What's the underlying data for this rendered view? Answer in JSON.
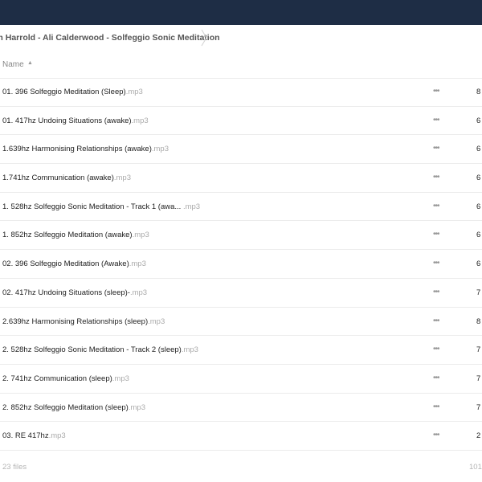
{
  "breadcrumb": {
    "text": "nn Harrold - Ali Calderwood - Solfeggio Sonic Meditation"
  },
  "header": {
    "name_label": "Name",
    "sort_icon": "sort-ascending-icon"
  },
  "files": [
    {
      "name": "01. 396 Solfeggio Meditation (Sleep)",
      "ext": ".mp3",
      "size": "8"
    },
    {
      "name": "01. 417hz Undoing Situations (awake)",
      "ext": ".mp3",
      "size": "6"
    },
    {
      "name": "1.639hz Harmonising Relationships (awake)",
      "ext": ".mp3",
      "size": "6"
    },
    {
      "name": "1.741hz Communication (awake)",
      "ext": ".mp3",
      "size": "6"
    },
    {
      "name": "1. 528hz Solfeggio Sonic Meditation - Track 1 (awa...",
      "ext": " .mp3",
      "size": "6"
    },
    {
      "name": "1. 852hz Solfeggio Meditation (awake)",
      "ext": ".mp3",
      "size": "6"
    },
    {
      "name": "02. 396 Solfeggio Meditation (Awake)",
      "ext": ".mp3",
      "size": "6"
    },
    {
      "name": "02. 417hz Undoing Situations (sleep)-",
      "ext": ".mp3",
      "size": "7"
    },
    {
      "name": "2.639hz Harmonising Relationships (sleep)",
      "ext": ".mp3",
      "size": "8"
    },
    {
      "name": "2. 528hz Solfeggio Sonic Meditation - Track 2 (sleep)",
      "ext": ".mp3",
      "size": "7"
    },
    {
      "name": "2. 741hz Communication (sleep)",
      "ext": ".mp3",
      "size": "7"
    },
    {
      "name": "2. 852hz Solfeggio Meditation (sleep)",
      "ext": ".mp3",
      "size": "7"
    },
    {
      "name": "03. RE 417hz",
      "ext": ".mp3",
      "size": "2"
    }
  ],
  "row_menu_label": "•••",
  "footer": {
    "count": "23 files",
    "total": "101"
  },
  "colors": {
    "topbar": "#1e2d45",
    "extension": "#aaaaaa"
  }
}
